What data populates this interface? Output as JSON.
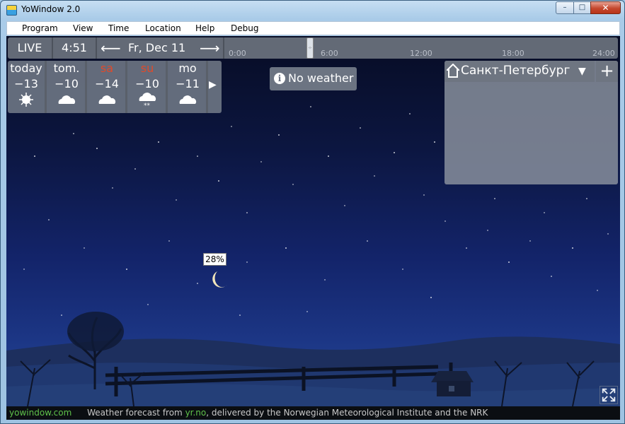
{
  "window": {
    "title": "YoWindow 2.0",
    "controls": {
      "minimize": "–",
      "maximize": "□",
      "close": "✕"
    }
  },
  "menu": [
    "Program",
    "View",
    "Time",
    "Location",
    "Help",
    "Debug"
  ],
  "timebar": {
    "live_label": "LIVE",
    "clock": "4:51",
    "prev_arrow": "⟵",
    "date": "Fr, Dec 11",
    "next_arrow": "⟶",
    "timeline_labels": [
      "0:00",
      "6:00",
      "12:00",
      "18:00",
      "24:00"
    ],
    "handle_glyph": "‹›"
  },
  "forecast": {
    "days": [
      {
        "name": "today",
        "temp": "−13",
        "icon": "sun-icon",
        "weekend": false
      },
      {
        "name": "tom.",
        "temp": "−10",
        "icon": "cloud-icon",
        "weekend": false
      },
      {
        "name": "sa",
        "temp": "−14",
        "icon": "cloud-icon",
        "weekend": true
      },
      {
        "name": "su",
        "temp": "−10",
        "icon": "cloud-snow-icon",
        "weekend": true
      },
      {
        "name": "mo",
        "temp": "−11",
        "icon": "cloud-icon",
        "weekend": false
      }
    ],
    "next_glyph": "▶"
  },
  "no_weather": {
    "icon_glyph": "i",
    "label": "No weather"
  },
  "location": {
    "name": "Санкт-Петербург",
    "dropdown_glyph": "▼",
    "add_glyph": "+"
  },
  "moon": {
    "phase_label": "28%"
  },
  "status": {
    "site": "yowindow.com",
    "text_before": "Weather forecast from ",
    "provider": "yr.no",
    "text_after": ", delivered by the Norwegian Meteorological Institute and the NRK"
  },
  "colors": {
    "weekend": "#e04a2a",
    "status_link": "#5fc24a",
    "sky_top": "#070c24",
    "sky_bottom": "#264a9a"
  }
}
